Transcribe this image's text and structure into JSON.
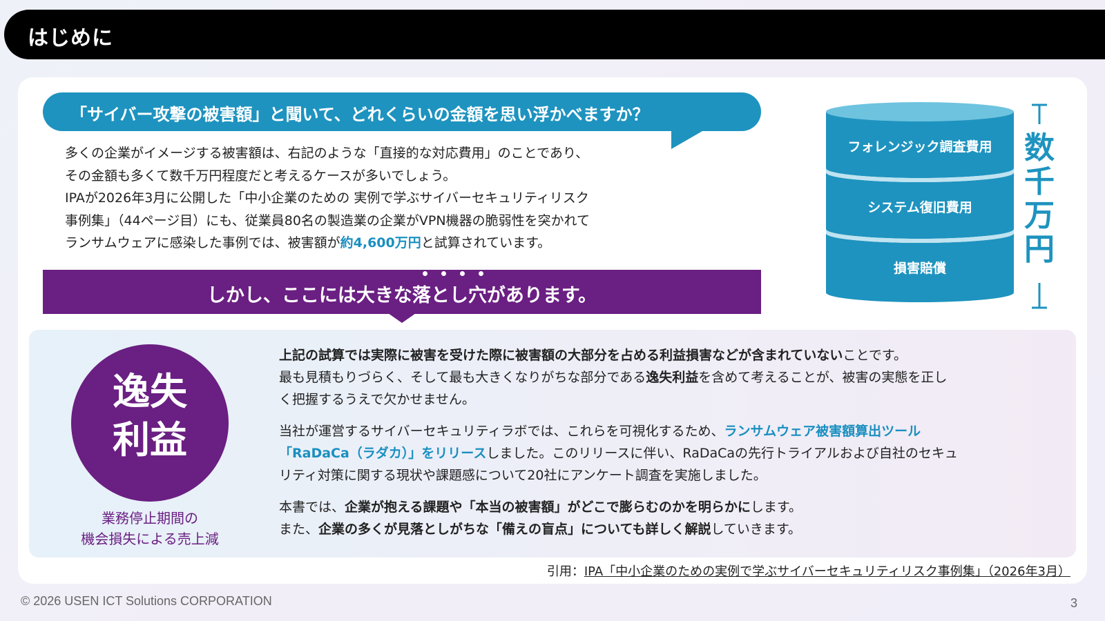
{
  "header": {
    "title": "はじめに"
  },
  "question": "「サイバー攻撃の被害額」と聞いて、どれくらいの金額を思い浮かべますか？",
  "intro": {
    "line1": "多くの企業がイメージする被害額は、右記のような「直接的な対応費用」のことであり、",
    "line2": "その金額も多くて数千万円程度だと考えるケースが多いでしょう。",
    "line3": "IPAが2026年3月に公開した「中小企業のための 実例で学ぶサイバーセキュリティリスク",
    "line4": "事例集」（44ページ目）にも、従業員80名の製造業の企業がVPN機器の脆弱性を突かれて",
    "line5_a": "ランサムウェアに感染した事例では、被害額が",
    "line5_b": "約4,600万円",
    "line5_c": "と試算されています。"
  },
  "banner": "しかし、ここには大きな落とし穴があります。",
  "cylinder": {
    "layers": [
      "フォレンジック調査費用",
      "システム復旧費用",
      "損害賠償"
    ],
    "amount_chars": [
      "数",
      "千",
      "万",
      "円"
    ]
  },
  "concept": {
    "circle_line1": "逸失",
    "circle_line2": "利益",
    "caption_line1": "業務停止期間の",
    "caption_line2": "機会損失による売上減"
  },
  "body": {
    "p1_l1_bold": "上記の試算では実際に被害を受けた際に被害額の大部分を占める利益損害などが含まれていない",
    "p1_l1_rest": "ことです。",
    "p1_l2_a": "最も見積もりづらく、そして最も大きくなりがちな部分である",
    "p1_l2_bold": "逸失利益",
    "p1_l2_c": "を含めて考えることが、被害の実態を正し",
    "p1_l3": "く把握するうえで欠かせません。",
    "p2_l1_a": "当社が運営するサイバーセキュリティラボでは、これらを可視化するため、",
    "p2_l1_link": "ランサムウェア被害額算出ツール",
    "p2_l2_link": "「RaDaCa（ラダカ）」をリリース",
    "p2_l2_rest": "しました。このリリースに伴い、RaDaCaの先行トライアルおよび自社のセキュ",
    "p2_l3": "リティ対策に関する現状や課題感について20社にアンケート調査を実施しました。",
    "p3_l1_a": "本書では、",
    "p3_l1_bold": "企業が抱える課題や「本当の被害額」がどこで膨らむのかを明らかに",
    "p3_l1_c": "します。",
    "p3_l2_a": "また、",
    "p3_l2_bold": "企業の多くが見落としがちな「備えの盲点」についても詳しく解説",
    "p3_l2_c": "していきます。"
  },
  "citation": {
    "prefix": "引用：",
    "link": "IPA「中小企業のための実例で学ぶサイバーセキュリティリスク事例集」（2026年3月）"
  },
  "footer": {
    "copyright": "© 2026 USEN ICT Solutions CORPORATION",
    "page": "3"
  },
  "colors": {
    "accent_blue": "#1e93bf",
    "accent_purple": "#6a1f82"
  }
}
